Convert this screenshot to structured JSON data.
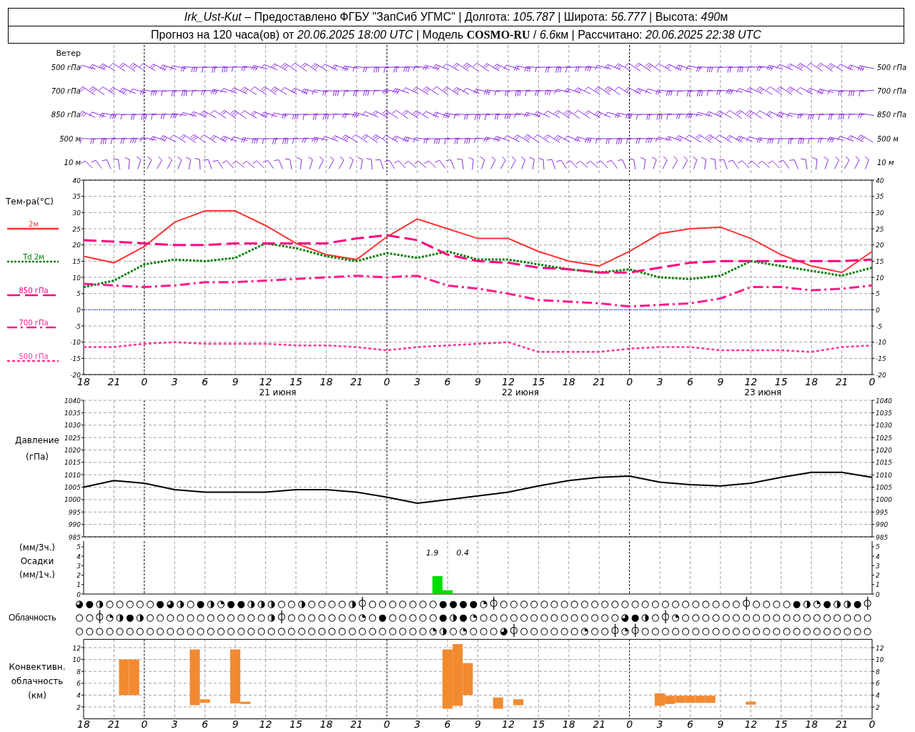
{
  "header": {
    "line_1": [
      "Irk_Ust-Kut",
      " – Предоставлено ФГБУ \"ЗапСиб УГМС\" | Долгота: ",
      "105.787",
      " | Широта: ",
      "56.777",
      " | Высота: ",
      "490",
      "м"
    ],
    "line_2": [
      "Прогноз на 120 часа(ов) от ",
      "20.06.2025 18:00 UTC",
      " | Модель ",
      "COSMO-RU",
      " / ",
      "6.6",
      "км | Рассчитано: ",
      "20.06.2025 22:38 UTC"
    ]
  },
  "wind": {
    "title": "Ветер",
    "levels_left": [
      "500 гПа",
      "700 гПа",
      "850 гПа",
      "500 м",
      "10 м"
    ],
    "levels_right": [
      "500 гПа",
      "700 гПа",
      "850 гПа",
      "500 м",
      "10 м"
    ]
  },
  "temperature": {
    "dates": [
      "21 июня",
      "22 июня",
      "23 июня"
    ],
    "left_ticks": [
      "40",
      "35",
      "30",
      "25",
      "20",
      "15",
      "10",
      "5",
      "0",
      "-5",
      "-10",
      "-15",
      "-20"
    ],
    "right_ticks": [
      "40",
      "35",
      "30",
      "25",
      "20",
      "15",
      "10",
      "5",
      "0",
      "-5",
      "-10",
      "-15",
      "-20"
    ],
    "chart_data": {
      "type": "line",
      "ylabel": "Тем-ра(°C)",
      "grid": true,
      "categories": [
        "18",
        "21",
        "0",
        "3",
        "6",
        "9",
        "12",
        "15",
        "18",
        "21",
        "0",
        "3",
        "6",
        "9",
        "12",
        "15",
        "18",
        "21",
        "0",
        "3",
        "6",
        "9",
        "12",
        "15",
        "18",
        "21",
        "0"
      ],
      "ylim": [
        -20,
        40
      ],
      "yticks": [
        -20,
        -15,
        -10,
        -5,
        0,
        5,
        10,
        15,
        20,
        25,
        30,
        35,
        40
      ],
      "ref_lines": [
        {
          "axis": "y",
          "value": 0,
          "color": "#3050ff"
        }
      ],
      "series": [
        {
          "name": "2м",
          "color": "#ff3333",
          "line_style": "solid",
          "values": [
            16.5,
            14.5,
            19.5,
            27,
            30.5,
            30.5,
            26,
            20.5,
            17,
            15.5,
            22.5,
            28,
            25,
            22,
            22,
            18,
            15,
            13.5,
            18,
            23.5,
            25,
            25.5,
            22,
            17,
            13.5,
            11.5,
            18
          ]
        },
        {
          "name": "Td 2м",
          "color": "#008000",
          "line_style": "dotted",
          "values": [
            7,
            9,
            14,
            15.5,
            15,
            16,
            20.5,
            19,
            16.5,
            15,
            17.5,
            16,
            18,
            15.5,
            15.5,
            14,
            12.5,
            11.5,
            12.5,
            10,
            9.5,
            10.5,
            15,
            13.5,
            12,
            10.5,
            13
          ]
        },
        {
          "name": "850 гПа",
          "color": "#ff0080",
          "line_style": "dashed",
          "values": [
            21.5,
            21,
            20.5,
            20,
            20,
            20.5,
            20.5,
            20.5,
            20.5,
            22,
            23,
            21.5,
            17,
            15,
            14.5,
            13,
            12.5,
            11.5,
            11.5,
            13,
            14.5,
            15,
            15,
            15,
            15,
            15,
            15.5
          ]
        },
        {
          "name": "700 гПа",
          "color": "#ff1a8c",
          "line_style": "dash-dot",
          "values": [
            8,
            7.5,
            7,
            7.5,
            8.5,
            8.5,
            9,
            9.5,
            10,
            10.5,
            10,
            10.5,
            7.5,
            6.5,
            5,
            3,
            2.5,
            2,
            1,
            1.5,
            2,
            3.5,
            7,
            7,
            6,
            6.5,
            7.5
          ]
        },
        {
          "name": "500 гПа",
          "color": "#ff3399",
          "line_style": "short-dashed",
          "values": [
            -11.5,
            -11.5,
            -10.5,
            -10,
            -10.5,
            -10.5,
            -10.5,
            -11,
            -11,
            -11.5,
            -12.5,
            -11.5,
            -11,
            -10.5,
            -10,
            -13,
            -13,
            -13,
            -12,
            -11.5,
            -11.5,
            -12.5,
            -12.5,
            -12.5,
            -13,
            -11.5,
            -11
          ]
        }
      ]
    }
  },
  "pressure": {
    "unit_label": "(гПа)",
    "left_ticks": [
      "1040",
      "1035",
      "1030",
      "1025",
      "1020",
      "1015",
      "1010",
      "1005",
      "1000",
      "995",
      "990",
      "985"
    ],
    "right_ticks": [
      "1040",
      "1035",
      "1030",
      "1025",
      "1020",
      "1015",
      "1010",
      "1005",
      "1000",
      "995",
      "990",
      "985"
    ],
    "chart_data": {
      "type": "line",
      "ylabel": "Давление",
      "grid": true,
      "categories": [
        null,
        null,
        null,
        null,
        null,
        null,
        null,
        null,
        null,
        null,
        null,
        null,
        null,
        null,
        null,
        null,
        null,
        null,
        null,
        null,
        null,
        null,
        null,
        null,
        null,
        null,
        null
      ],
      "ylim": [
        985,
        1040
      ],
      "yticks": [
        985,
        990,
        995,
        1000,
        1005,
        1010,
        1015,
        1020,
        1025,
        1030,
        1035,
        1040
      ],
      "series": [
        {
          "color": "#000000",
          "values": [
            1005,
            1007.7,
            1006.6,
            1004,
            1003,
            1003,
            1003,
            1004,
            1004,
            1003,
            1001,
            998.5,
            1000,
            1001.5,
            1003,
            1005.5,
            1007.7,
            1009,
            1009.5,
            1007,
            1006,
            1005.5,
            1006.6,
            1009,
            1011,
            1011,
            1009
          ]
        }
      ]
    }
  },
  "precipitation": {
    "labels": [
      "(мм/3ч.)",
      "Осадки",
      "(мм/1ч.)"
    ],
    "left_ticks": [
      "5",
      "4",
      "3",
      "2",
      "1",
      "0"
    ],
    "right_ticks": [
      "5",
      "4",
      "3",
      "2",
      "1",
      "0"
    ],
    "chart_data": {
      "type": "bar",
      "grid": true,
      "categories": [
        null,
        null,
        null,
        null,
        null,
        null,
        null,
        null,
        null,
        null,
        null,
        null,
        null,
        null,
        null,
        null,
        null,
        null,
        null,
        null,
        null,
        null,
        null,
        null,
        null,
        null,
        null,
        null,
        null,
        null,
        null,
        null,
        null,
        null,
        null,
        null,
        null,
        null,
        null,
        null,
        null,
        null,
        null,
        null,
        null,
        null,
        null,
        null,
        null,
        null,
        null,
        null,
        null,
        null,
        null,
        null,
        null,
        null,
        null,
        null,
        null,
        null,
        null,
        null,
        null,
        null,
        null,
        null,
        null,
        null,
        null,
        null,
        null,
        null,
        null,
        null,
        null,
        null,
        null
      ],
      "ylim": [
        0,
        5.6
      ],
      "yticks": [
        0,
        1,
        2,
        3,
        4,
        5
      ],
      "series": [
        {
          "color": "#00dd00",
          "values": [
            null,
            null,
            null,
            null,
            null,
            null,
            null,
            null,
            null,
            null,
            null,
            null,
            null,
            null,
            null,
            null,
            null,
            null,
            null,
            null,
            null,
            null,
            null,
            null,
            null,
            null,
            null,
            null,
            null,
            null,
            null,
            null,
            null,
            null,
            null,
            1.9,
            0.4,
            null,
            null,
            null,
            null,
            null,
            null,
            null,
            null,
            null,
            null,
            null,
            null,
            null,
            null,
            null,
            null,
            null,
            null,
            null,
            null,
            null,
            null,
            null,
            null,
            null,
            null,
            null,
            null,
            null,
            null,
            null,
            null,
            null,
            null,
            null,
            null,
            null,
            null,
            null,
            null,
            null,
            null
          ]
        }
      ],
      "annotations": [
        "1.9",
        "0.4"
      ]
    }
  },
  "cloudiness": {
    "label": "Облачность",
    "rows": [
      "◕●◑○○○○○●◕◑○●◑◔●●◑◑◑○○◑○○○○◑⌽○○○○○○○●●●●◔⌽○○○○○○○○○○○○○○○○○○○○○○○○⌽○○○○●◑◔●◑◑●⌽",
      "○○⌽◔◑●◑○○○○○○○○○○○○◑⌽○○○○○○○◔○●○○○○○●◑●◔○○○○○○○○○○○○○○◕●◑○⌽◔○○○○○○○○○○○○○○○○○○○",
      "○○○○○○○○○○○○○○○○○○○○○○○○○○○○○○○○○○○◔◑○◔○○○◕⌽○○○○○○◔○○⌽◔⌽○○○○○○○○○○○○○○○○○○○○○○○"
    ]
  },
  "convective": {
    "labels": [
      "Конвективн.",
      "облачность",
      "(км)"
    ],
    "left_ticks": [
      "12",
      "10",
      "8",
      "6",
      "4",
      "2"
    ],
    "right_ticks": [
      "12",
      "10",
      "8",
      "6",
      "4",
      "2"
    ],
    "chart_data": {
      "type": "bar",
      "grid": true,
      "categories": [
        "18",
        null,
        null,
        "21",
        null,
        null,
        "0",
        null,
        null,
        "3",
        null,
        null,
        "6",
        null,
        null,
        "9",
        null,
        null,
        "12",
        null,
        null,
        "15",
        null,
        null,
        "18",
        null,
        null,
        "21",
        null,
        null,
        "0",
        null,
        null,
        "3",
        null,
        null,
        "6",
        null,
        null,
        "9",
        null,
        null,
        "12",
        null,
        null,
        "15",
        null,
        null,
        "18",
        null,
        null,
        "21",
        null,
        null,
        "0",
        null,
        null,
        "3",
        null,
        null,
        "6",
        null,
        null,
        "9",
        null,
        null,
        "12",
        null,
        null,
        "15",
        null,
        null,
        "18",
        null,
        null,
        "21",
        null,
        null,
        "0"
      ],
      "ylim": [
        0,
        13.4
      ],
      "yticks": [
        2,
        4,
        6,
        8,
        10,
        12
      ],
      "series": [
        {
          "color": "#f28a30",
          "values": [
            null,
            null,
            null,
            null,
            6,
            6,
            null,
            null,
            null,
            null,
            null,
            9.4,
            0.6,
            null,
            null,
            9.1,
            0.4,
            null,
            null,
            null,
            null,
            null,
            null,
            null,
            null,
            null,
            null,
            null,
            null,
            null,
            null,
            null,
            null,
            null,
            null,
            null,
            10,
            10.4,
            5.4,
            null,
            null,
            1.9,
            null,
            1,
            null,
            null,
            null,
            null,
            null,
            null,
            null,
            null,
            null,
            null,
            null,
            null,
            null,
            2.1,
            1.4,
            1.2,
            1.2,
            1.2,
            1.2,
            null,
            null,
            null,
            0.5,
            null,
            null,
            null,
            null,
            null,
            null,
            null,
            null,
            null,
            null,
            null,
            null
          ],
          "base": [
            null,
            null,
            null,
            null,
            4,
            4,
            null,
            null,
            null,
            null,
            null,
            2.3,
            2.7,
            null,
            null,
            2.6,
            2.5,
            null,
            null,
            null,
            null,
            null,
            null,
            null,
            null,
            null,
            null,
            null,
            null,
            null,
            null,
            null,
            null,
            null,
            null,
            null,
            1.7,
            2.2,
            4,
            null,
            null,
            1.7,
            null,
            2.3,
            null,
            null,
            null,
            null,
            null,
            null,
            null,
            null,
            null,
            null,
            null,
            null,
            null,
            2.2,
            2.5,
            2.7,
            2.7,
            2.7,
            2.7,
            null,
            null,
            null,
            2.4,
            null,
            null,
            null,
            null,
            null,
            null,
            null,
            null,
            null,
            null,
            null,
            null
          ]
        }
      ]
    }
  }
}
